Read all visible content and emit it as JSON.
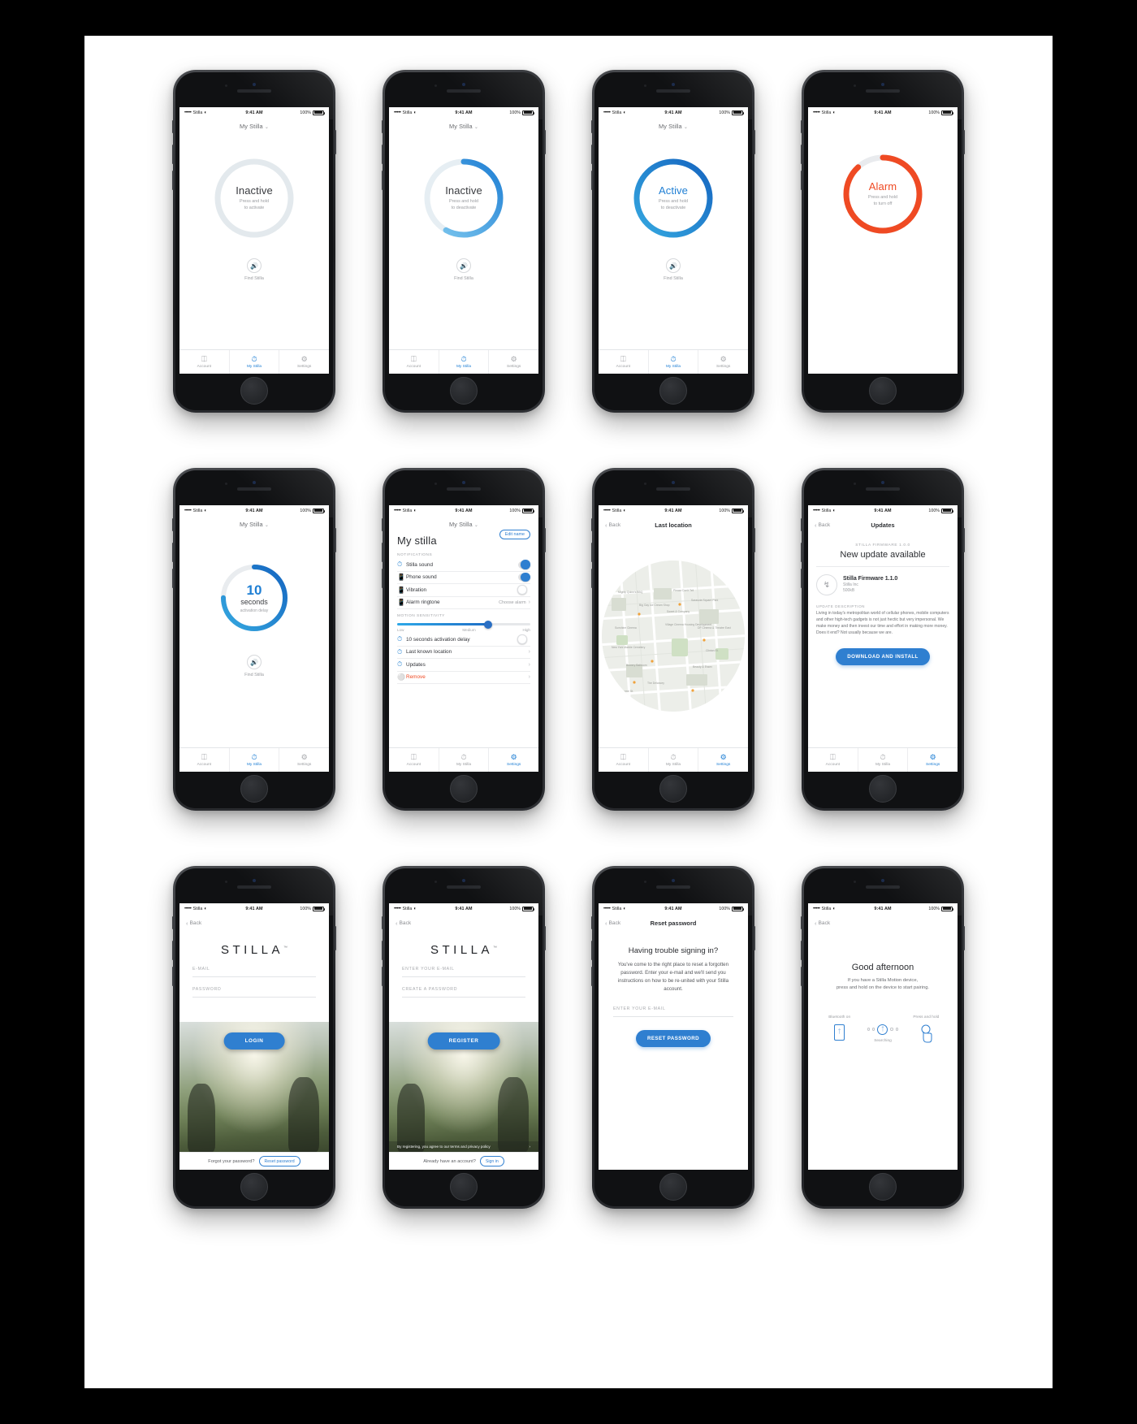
{
  "status_bar": {
    "carrier": "Stilla",
    "signal": "•••••",
    "wifi_icon": "wifi-icon",
    "time": "9:41 AM",
    "battery": "100%"
  },
  "accent": {
    "blue": "#2f7fd0",
    "light_blue": "#2ea8e8",
    "red": "#ef4a23",
    "grey": "#dfe3e6"
  },
  "tabs": {
    "account": "Account",
    "my_stilla": "My Stilla",
    "settings": "Settings"
  },
  "screens": {
    "inactive": {
      "nav_title": "My Stilla",
      "caret": "⌄",
      "status": "Inactive",
      "hint_line1": "Press and hold",
      "hint_line2": "to activate",
      "find_label": "Find Stilla",
      "ring_progress": 0
    },
    "activating": {
      "nav_title": "My Stilla",
      "status": "Inactive",
      "hint_line1": "Press and hold",
      "hint_line2": "to deactivate",
      "find_label": "Find Stilla",
      "ring_progress": 58
    },
    "active": {
      "nav_title": "My Stilla",
      "status": "Active",
      "hint_line1": "Press and hold",
      "hint_line2": "to deactivate",
      "find_label": "Find Stilla",
      "ring_progress": 100
    },
    "alarm": {
      "nav_title": "My Stilla",
      "status": "Alarm",
      "hint_line1": "Press and hold",
      "hint_line2": "to turn off",
      "ring_progress": 88
    },
    "countdown": {
      "nav_title": "My Stilla",
      "number": "10",
      "unit": "seconds",
      "caption": "activation delay",
      "find_label": "Find Stilla",
      "ring_progress": 75
    },
    "settings": {
      "nav_title": "My Stilla",
      "page_title": "My stilla",
      "edit_button": "Edit name",
      "notifications_label": "NOTIFICATIONS",
      "rows": [
        {
          "icon": "clock-icon",
          "label": "Stilla sound",
          "control": "toggle",
          "value": "on"
        },
        {
          "icon": "phone-icon",
          "label": "Phone sound",
          "control": "toggle",
          "value": "on"
        },
        {
          "icon": "phone-icon",
          "label": "Vibration",
          "control": "toggle",
          "value": "off"
        },
        {
          "icon": "phone-icon",
          "label": "Alarm ringtone",
          "control": "value",
          "value": "Choose alarm"
        }
      ],
      "sensitivity_label": "MOTION SENSITIVITY",
      "sensitivity_low": "Low",
      "sensitivity_medium": "Medium",
      "sensitivity_high": "High",
      "rows2": [
        {
          "icon": "clock-icon",
          "label": "10 seconds activation delay",
          "control": "toggle",
          "value": "off"
        },
        {
          "icon": "clock-icon",
          "label": "Last known location",
          "control": "chevron"
        },
        {
          "icon": "clock-icon",
          "label": "Updates",
          "control": "chevron"
        },
        {
          "icon": "remove-icon",
          "label": "Remove",
          "control": "chevron",
          "danger": true
        }
      ]
    },
    "map": {
      "back": "Back",
      "title": "Last location",
      "pin": "location-pin-icon",
      "labels": [
        "Mighty Quinn's BBQ",
        "Please Don't Tell",
        "Big Gay Ice Cream Shop",
        "Sunshine Cinema",
        "Village Pourhouse",
        "Sarah Roosevelt Park",
        "Sweet & Company",
        "DF Cinema & Theatre East",
        "New York Marble Cemetery",
        "Bowery Ballroom",
        "Beauty & Essex",
        "The Delancey",
        "Clinton St."
      ]
    },
    "updates": {
      "back": "Back",
      "title": "Updates",
      "kicker": "STILLA FIRMWARE 1.0.0",
      "heading": "New update available",
      "firmware_name": "Stilla Firmware 1.1.0",
      "vendor": "Stilla Inc",
      "size": "500kB",
      "desc_label": "UPDATE DESCRIPTION",
      "description": "Living in today's metropolitan world of cellular phones, mobile computers and other high-tech gadgets is not just hectic but very impersonal. We make money and then invest our time and effort in making more money. Does it end? Not usually because we are.",
      "cta": "DOWNLOAD AND INSTALL",
      "download_icon": "download-icon"
    },
    "login": {
      "back": "Back",
      "brand": "STILLA",
      "brand_tm": "™",
      "email_label": "E-MAIL",
      "password_label": "PASSWORD",
      "cta": "LOGIN",
      "footer_text": "Forgot your password?",
      "footer_button": "Reset password"
    },
    "register": {
      "back": "Back",
      "brand": "STILLA",
      "brand_tm": "™",
      "email_label": "ENTER YOUR E-MAIL",
      "password_label": "CREATE A PASSWORD",
      "cta": "REGISTER",
      "terms": "By registering, you agree to our terms and privacy policy",
      "terms_chevron": "›",
      "footer_text": "Already have an account?",
      "footer_button": "Sign in"
    },
    "reset": {
      "back": "Back",
      "title": "Reset password",
      "heading": "Having trouble signing in?",
      "body": "You've come to the right place to reset a forgotten password. Enter your e-mail and we'll send you instructions on how to be re-united with your Stilla account.",
      "email_label": "ENTER YOUR E-MAIL",
      "cta": "RESET PASSWORD"
    },
    "pairing": {
      "back": "Back",
      "heading": "Good afternoon",
      "body_line1": "If you have a Stilla Motion device,",
      "body_line2": "press and hold on the device to start pairing.",
      "col1_caption": "Bluetooth on",
      "col2_caption": "Searching",
      "col3_caption": "Press and hold",
      "bluetooth_icon": "bluetooth-icon",
      "phone_icon": "phone-icon",
      "hand_icon": "hand-press-icon"
    }
  }
}
